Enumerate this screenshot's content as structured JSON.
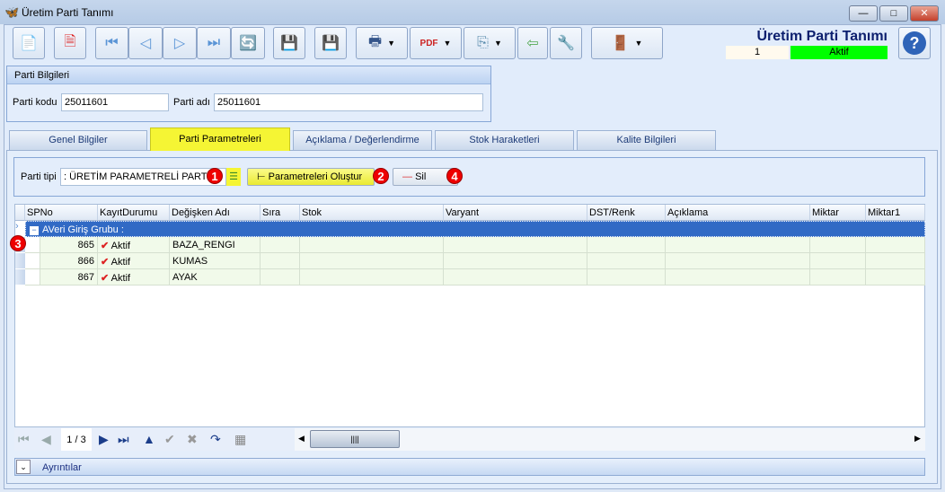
{
  "window": {
    "title": "Üretim Parti Tanımı",
    "minimize": "—",
    "maximize": "□",
    "close": "✕"
  },
  "toolbar": {
    "buttons": [
      {
        "name": "new-record-button",
        "icon": "📄"
      },
      {
        "name": "delete-record-button",
        "icon": "🗎"
      },
      {
        "name": "first-record-button",
        "icon": "⏮"
      },
      {
        "name": "prev-record-button",
        "icon": "◁"
      },
      {
        "name": "next-record-button",
        "icon": "▷"
      },
      {
        "name": "last-record-button",
        "icon": "⏭"
      },
      {
        "name": "refresh-button",
        "icon": "🔄"
      },
      {
        "name": "save-button",
        "icon": "💾"
      },
      {
        "name": "cancel-save-button",
        "icon": "💾"
      },
      {
        "name": "print-button",
        "icon": "🖶"
      },
      {
        "name": "pdf-export-button",
        "icon": "PDF"
      },
      {
        "name": "export-button",
        "icon": "⎘"
      },
      {
        "name": "import-button",
        "icon": "⇦"
      },
      {
        "name": "settings-button",
        "icon": "🔧"
      },
      {
        "name": "exit-button",
        "icon": "🚪"
      }
    ],
    "help": "?"
  },
  "header": {
    "title": "Üretim Parti Tanımı",
    "record_no": "1",
    "status": "Aktif",
    "status_color": "#00ff00"
  },
  "parti_bilgileri": {
    "title": "Parti Bilgileri",
    "kod_label": "Parti kodu",
    "kod_value": "25011601",
    "ad_label": "Parti adı",
    "ad_value": "25011601"
  },
  "tabs": [
    "Genel Bilgiler",
    "Parti Parametreleri",
    "Açıklama / Değerlendirme",
    "Stok Haraketleri",
    "Kalite Bilgileri"
  ],
  "params": {
    "tip_label": "Parti tipi",
    "tip_value": ": ÜRETİM PARAMETRELİ PARTİ K",
    "create_button": "Parametreleri Oluştur",
    "delete_button": "Sil",
    "badges": [
      "1",
      "2",
      "3",
      "4"
    ]
  },
  "grid": {
    "columns": [
      "SPNo",
      "KayıtDurumu",
      "Değişken Adı",
      "Sıra",
      "Stok",
      "Varyant",
      "DST/Renk",
      "Açıklama",
      "Miktar",
      "Miktar1"
    ],
    "group": "AVeri Giriş Grubu :",
    "rows": [
      [
        "865",
        "Aktif",
        "BAZA_RENGI"
      ],
      [
        "866",
        "Aktif",
        "KUMAS"
      ],
      [
        "867",
        "Aktif",
        "AYAK"
      ]
    ]
  },
  "navigator": {
    "page": "1 / 3"
  },
  "details": {
    "label": "Ayrıntılar"
  }
}
